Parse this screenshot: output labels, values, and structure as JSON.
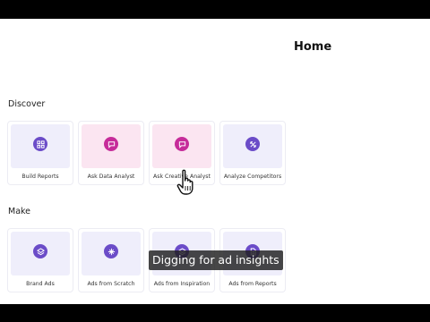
{
  "page": {
    "title": "Home"
  },
  "sections": [
    {
      "label": "Discover",
      "cards": [
        {
          "label": "Build Reports",
          "icon": "grid-analyze-icon",
          "thumb_color": "#efeefb",
          "badge_color": "#6b4cc8"
        },
        {
          "label": "Ask Data Analyst",
          "icon": "chat-bubble-icon",
          "thumb_color": "#fbe5f1",
          "badge_color": "#c62c9a"
        },
        {
          "label": "Ask Creative Analyst",
          "icon": "chat-bubble-icon",
          "thumb_color": "#fbe5f1",
          "badge_color": "#c62c9a"
        },
        {
          "label": "Analyze Competitors",
          "icon": "crossed-arrows-icon",
          "thumb_color": "#efeefb",
          "badge_color": "#6b4cc8"
        }
      ]
    },
    {
      "label": "Make",
      "cards": [
        {
          "label": "Brand Ads",
          "icon": "layers-icon",
          "thumb_color": "#efeefb",
          "badge_color": "#6b4cc8"
        },
        {
          "label": "Ads from Scratch",
          "icon": "sparkle-icon",
          "thumb_color": "#efeefb",
          "badge_color": "#6b4cc8"
        },
        {
          "label": "Ads from Inspiration",
          "icon": "layers-icon",
          "thumb_color": "#efeefb",
          "badge_color": "#6b4cc8"
        },
        {
          "label": "Ads from Reports",
          "icon": "document-icon",
          "thumb_color": "#efeefb",
          "badge_color": "#6b4cc8"
        }
      ]
    }
  ],
  "caption": {
    "text": "Digging for ad insights"
  }
}
